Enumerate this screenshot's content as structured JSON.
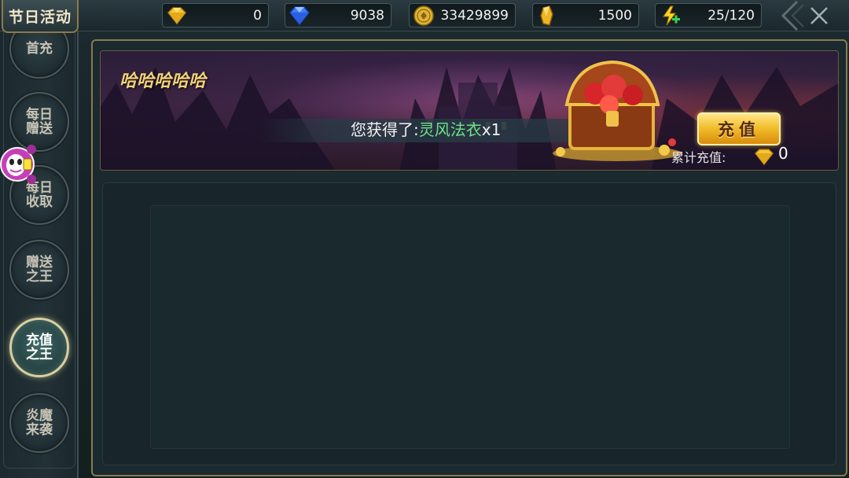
{
  "header": {
    "title": "节日活动"
  },
  "resources": [
    {
      "icon": "gold-gem-icon",
      "value": "0"
    },
    {
      "icon": "blue-diamond-icon",
      "value": "9038"
    },
    {
      "icon": "gold-coin-icon",
      "value": "33429899"
    },
    {
      "icon": "gold-crystal-icon",
      "value": "1500"
    },
    {
      "icon": "energy-bolt-icon",
      "value": "25/120"
    }
  ],
  "sidebar": {
    "items": [
      {
        "label": "首充",
        "active": false
      },
      {
        "label": "每日赠送",
        "active": false
      },
      {
        "label": "每日收取",
        "active": false
      },
      {
        "label": "赠送之王",
        "active": false
      },
      {
        "label": "充值之王",
        "active": true
      },
      {
        "label": "炎魔来袭",
        "active": false
      }
    ]
  },
  "banner": {
    "title": "哈哈哈哈哈",
    "message_prefix": "您获得了:",
    "message_item": "灵风法衣",
    "message_suffix": "x1",
    "recharge_label": "充值",
    "total_label": "累计充值:",
    "total_value": "0"
  },
  "colors": {
    "accent_gold": "#f3d27a",
    "item_green": "#6fe28a",
    "frame_gold": "#8a7a50"
  }
}
